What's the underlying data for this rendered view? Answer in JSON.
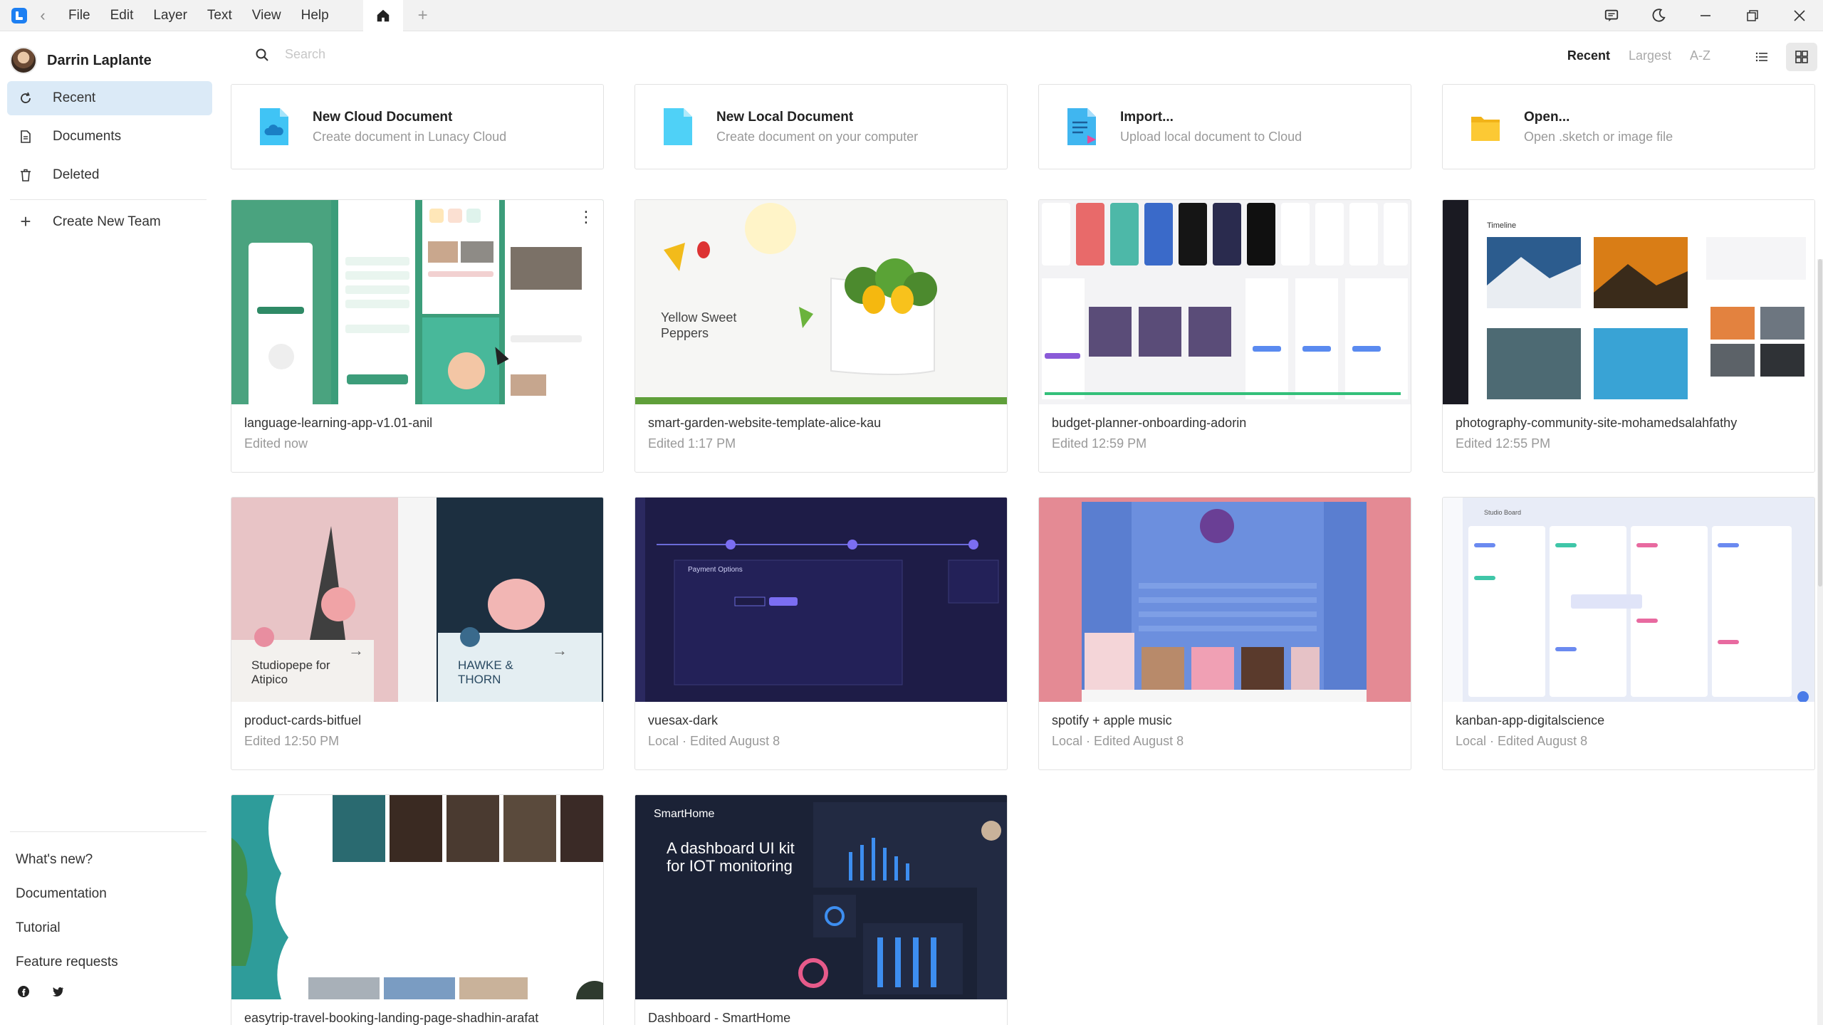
{
  "menu": [
    "File",
    "Edit",
    "Layer",
    "Text",
    "View",
    "Help"
  ],
  "user": {
    "name": "Darrin Laplante"
  },
  "sidebar": {
    "items": [
      {
        "label": "Recent",
        "icon": "clock-icon"
      },
      {
        "label": "Documents",
        "icon": "document-icon"
      },
      {
        "label": "Deleted",
        "icon": "trash-icon"
      }
    ],
    "create_team": "Create New Team",
    "footer": [
      "What's new?",
      "Documentation",
      "Tutorial",
      "Feature requests"
    ],
    "socials": [
      "facebook-icon",
      "twitter-icon"
    ]
  },
  "search": {
    "placeholder": "Search"
  },
  "sort": {
    "options": [
      "Recent",
      "Largest",
      "A-Z"
    ],
    "selected": "Recent"
  },
  "view": {
    "selected": "grid"
  },
  "actions": [
    {
      "title": "New Cloud Document",
      "subtitle": "Create document in Lunacy Cloud",
      "icon": "cloud-document-icon"
    },
    {
      "title": "New Local Document",
      "subtitle": "Create document on your computer",
      "icon": "local-document-icon"
    },
    {
      "title": "Import...",
      "subtitle": "Upload local document to Cloud",
      "icon": "import-icon"
    },
    {
      "title": "Open...",
      "subtitle": "Open .sketch or image file",
      "icon": "folder-icon"
    }
  ],
  "files": [
    {
      "name": "language-learning-app-v1.01-anil",
      "meta": "Edited now"
    },
    {
      "name": "smart-garden-website-template-alice-kau",
      "meta": "Edited 1:17 PM",
      "thumb_text": "Yellow Sweet Peppers"
    },
    {
      "name": "budget-planner-onboarding-adorin",
      "meta": "Edited 12:59 PM"
    },
    {
      "name": "photography-community-site-mohamedsalahfathy",
      "meta": "Edited 12:55 PM",
      "thumb_text": "Timeline"
    },
    {
      "name": "product-cards-bitfuel",
      "meta": "Edited 12:50 PM",
      "thumb_text": "Studiopepe for Atipico",
      "thumb_text2": "HAWKE & THORN"
    },
    {
      "name": "vuesax-dark",
      "meta": "Local · Edited August 8",
      "thumb_text": "Payment Options"
    },
    {
      "name": "spotify +  apple music",
      "meta": "Local · Edited August 8"
    },
    {
      "name": "kanban-app-digitalscience",
      "meta": "Local · Edited August 8",
      "thumb_text": "Studio Board"
    },
    {
      "name": "easytrip-travel-booking-landing-page-shadhin-arafat",
      "meta": ""
    },
    {
      "name": "Dashboard - SmartHome",
      "meta": "",
      "thumb_text": "A dashboard UI kit for IOT monitoring",
      "thumb_brand": "SmartHome"
    }
  ]
}
